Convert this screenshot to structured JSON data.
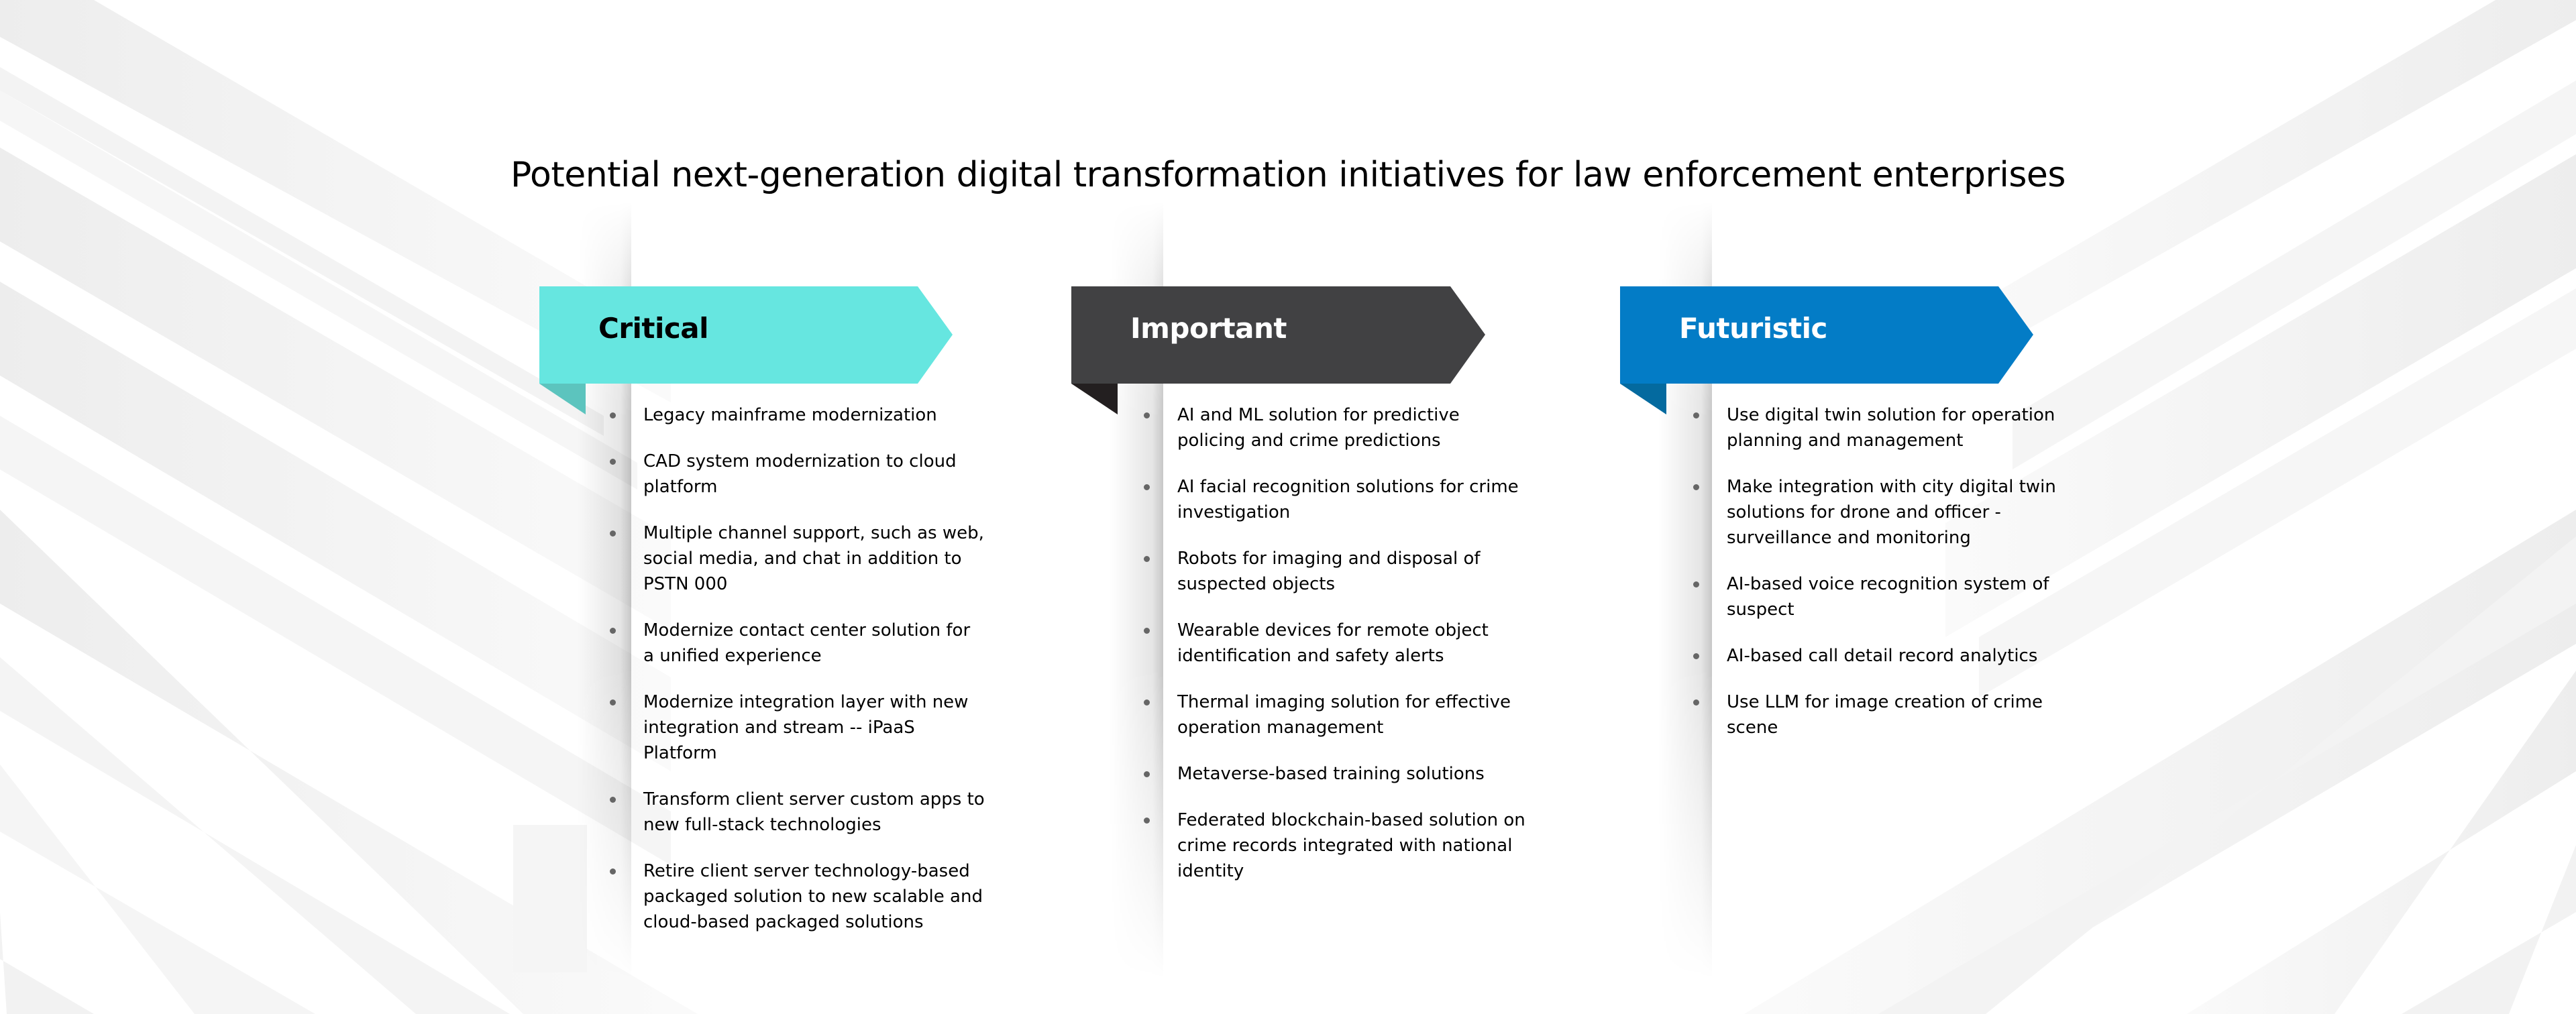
{
  "title": "Potential next-generation digital transformation initiatives for law enforcement enterprises",
  "colors": {
    "background": "#ffffff",
    "stripe": "#f1f1f1",
    "bullet": "#666666",
    "text": "#000000"
  },
  "columns": [
    {
      "label": "Critical",
      "ribbon_color": "#66E6E0",
      "fold_color": "#5CC4BE",
      "label_color": "#000000",
      "items": [
        "Legacy mainframe modernization",
        "CAD system modernization to cloud platform",
        "Multiple channel support, such as web, social media, and chat in addition to PSTN 000",
        "Modernize contact center solution for a unified experience",
        "Modernize integration layer with new integration and stream -- iPaaS Platform",
        "Transform client server custom apps to new full-stack technologies",
        "Retire client server technology-based packaged solution to new scalable and cloud-based packaged solutions"
      ]
    },
    {
      "label": "Important",
      "ribbon_color": "#414143",
      "fold_color": "#231F20",
      "label_color": "#FFFFFF",
      "items": [
        "AI and ML solution for predictive policing and crime predictions",
        "AI facial recognition solutions for crime investigation",
        "Robots for imaging and disposal of suspected objects",
        "Wearable devices for remote object identification and safety alerts",
        "Thermal imaging solution for effective operation management",
        "Metaverse-based training solutions",
        "Federated blockchain-based solution on crime records integrated with national identity"
      ]
    },
    {
      "label": "Futuristic",
      "ribbon_color": "#037CC6",
      "fold_color": "#046A9F",
      "label_color": "#FFFFFF",
      "items": [
        "Use digital twin solution for operation planning and management",
        "Make integration with city digital twin solutions for drone and officer - surveillance and monitoring",
        "AI-based voice recognition system of suspect",
        "AI-based call detail record analytics",
        "Use LLM for image creation of crime scene"
      ]
    }
  ]
}
